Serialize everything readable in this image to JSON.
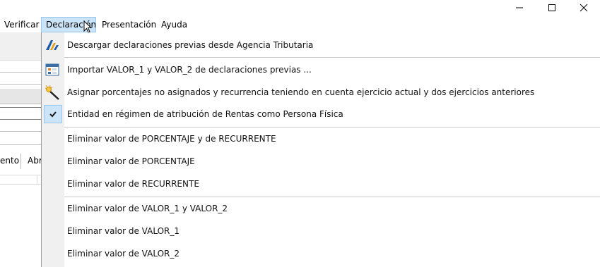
{
  "window_controls": {
    "minimize_glyph": "—",
    "maximize_glyph": "☐",
    "close_glyph": "✕"
  },
  "menubar": {
    "items": [
      {
        "label": "Verificar"
      },
      {
        "label": "Declaración"
      },
      {
        "label": "Presentación"
      },
      {
        "label": "Ayuda"
      }
    ]
  },
  "background": {
    "fragment_1": "ento",
    "fragment_2": "Abri"
  },
  "dropdown": {
    "items": [
      {
        "label": "Descargar declaraciones previas desde Agencia Tributaria",
        "icon": "agencia-tributaria-logo-icon"
      },
      {
        "label": "Importar VALOR_1 y VALOR_2 de declaraciones previas ...",
        "icon": "import-table-icon"
      },
      {
        "label": "Asignar porcentajes no asignados y recurrencia teniendo en cuenta ejercicio actual y dos ejercicios anteriores",
        "icon": "magic-wand-icon"
      },
      {
        "label": "Entidad en régimen de atribución de Rentas como Persona Física",
        "icon": "checkmark-icon",
        "checked": true
      },
      {
        "label": "Eliminar valor de PORCENTAJE y de RECURRENTE"
      },
      {
        "label": "Eliminar valor de PORCENTAJE"
      },
      {
        "label": "Eliminar valor de RECURRENTE"
      },
      {
        "label": "Eliminar valor de VALOR_1 y VALOR_2"
      },
      {
        "label": "Eliminar valor de VALOR_1"
      },
      {
        "label": "Eliminar valor de VALOR_2"
      }
    ]
  },
  "colors": {
    "menu_highlight": "#cce4f7",
    "menu_highlight_border": "#99c9ef",
    "gutter": "#f0f0f0",
    "separator": "#c8c8c8"
  }
}
